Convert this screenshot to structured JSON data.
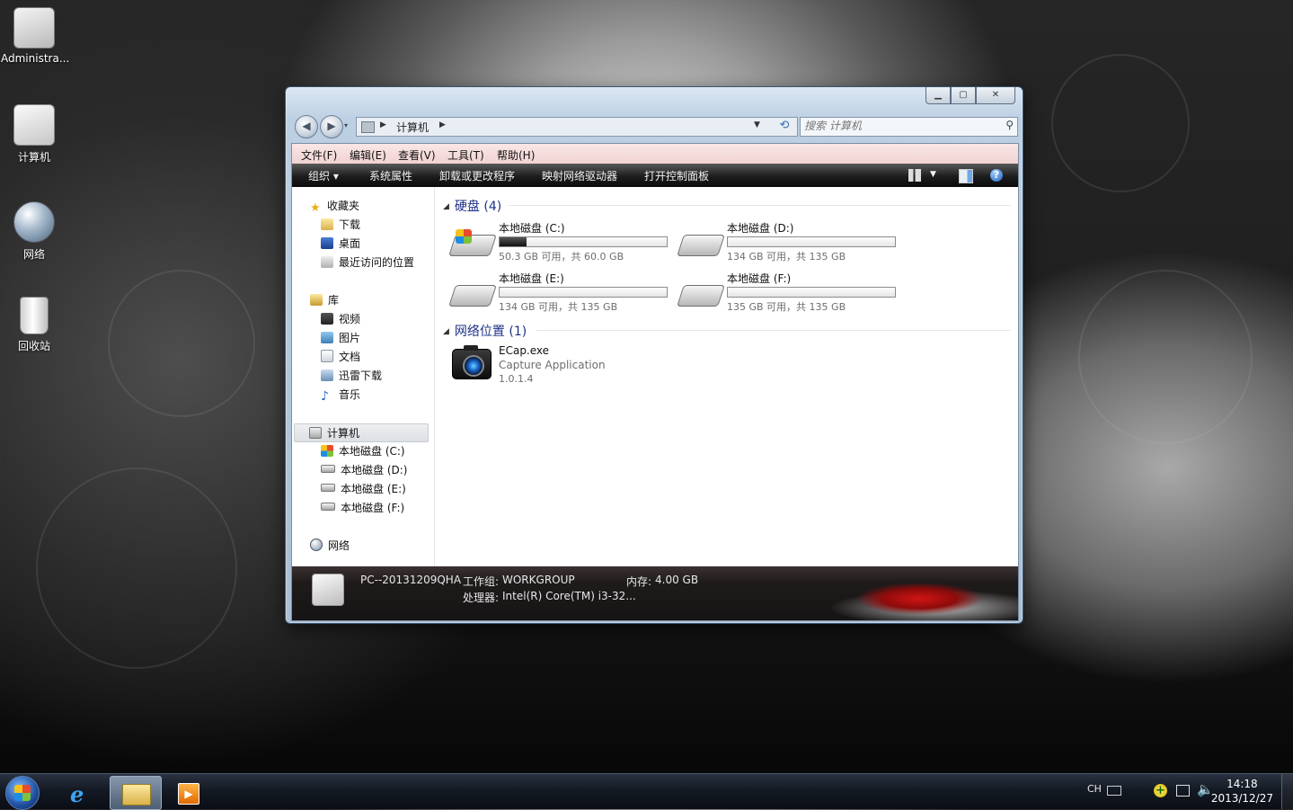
{
  "desktop": {
    "icons": [
      {
        "label": "Administra..."
      },
      {
        "label": "计算机"
      },
      {
        "label": "网络"
      },
      {
        "label": "回收站"
      }
    ]
  },
  "window": {
    "address": {
      "crumb": "计算机"
    },
    "search": {
      "placeholder": "搜索 计算机"
    },
    "menu": [
      "文件(F)",
      "编辑(E)",
      "查看(V)",
      "工具(T)",
      "帮助(H)"
    ],
    "commands": {
      "organize": "组织 ▾",
      "system_properties": "系统属性",
      "uninstall": "卸载或更改程序",
      "map_drive": "映射网络驱动器",
      "control_panel": "打开控制面板",
      "help_glyph": "?"
    },
    "sidebar": {
      "favorites": "收藏夹",
      "fav_items": [
        "下载",
        "桌面",
        "最近访问的位置"
      ],
      "libraries": "库",
      "lib_items": [
        "视频",
        "图片",
        "文档",
        "迅雷下载",
        "音乐"
      ],
      "computer": "计算机",
      "drives": [
        "本地磁盘 (C:)",
        "本地磁盘 (D:)",
        "本地磁盘 (E:)",
        "本地磁盘 (F:)"
      ],
      "network": "网络"
    },
    "hard_disks": {
      "header": "硬盘 (4)",
      "items": [
        {
          "name": "本地磁盘 (C:)",
          "free_text": "50.3 GB 可用，共 60.0 GB",
          "used_fraction": 0.16,
          "system": true
        },
        {
          "name": "本地磁盘 (D:)",
          "free_text": "134 GB 可用，共 135 GB",
          "used_fraction": 0.0,
          "system": false
        },
        {
          "name": "本地磁盘 (E:)",
          "free_text": "134 GB 可用，共 135 GB",
          "used_fraction": 0.0,
          "system": false
        },
        {
          "name": "本地磁盘 (F:)",
          "free_text": "135 GB 可用，共 135 GB",
          "used_fraction": 0.0,
          "system": false
        }
      ]
    },
    "network_locations": {
      "header": "网络位置 (1)",
      "item": {
        "name": "ECap.exe",
        "description": "Capture Application",
        "version": "1.0.1.4"
      }
    },
    "details": {
      "pc_name": "PC--20131209QHA",
      "workgroup_label": "工作组:",
      "workgroup_value": "WORKGROUP",
      "memory_label": "内存:",
      "memory_value": "4.00 GB",
      "cpu_label": "处理器:",
      "cpu_value": "Intel(R) Core(TM) i3-32..."
    }
  },
  "taskbar": {
    "lang": "CH",
    "time": "14:18",
    "date": "2013/12/27"
  }
}
